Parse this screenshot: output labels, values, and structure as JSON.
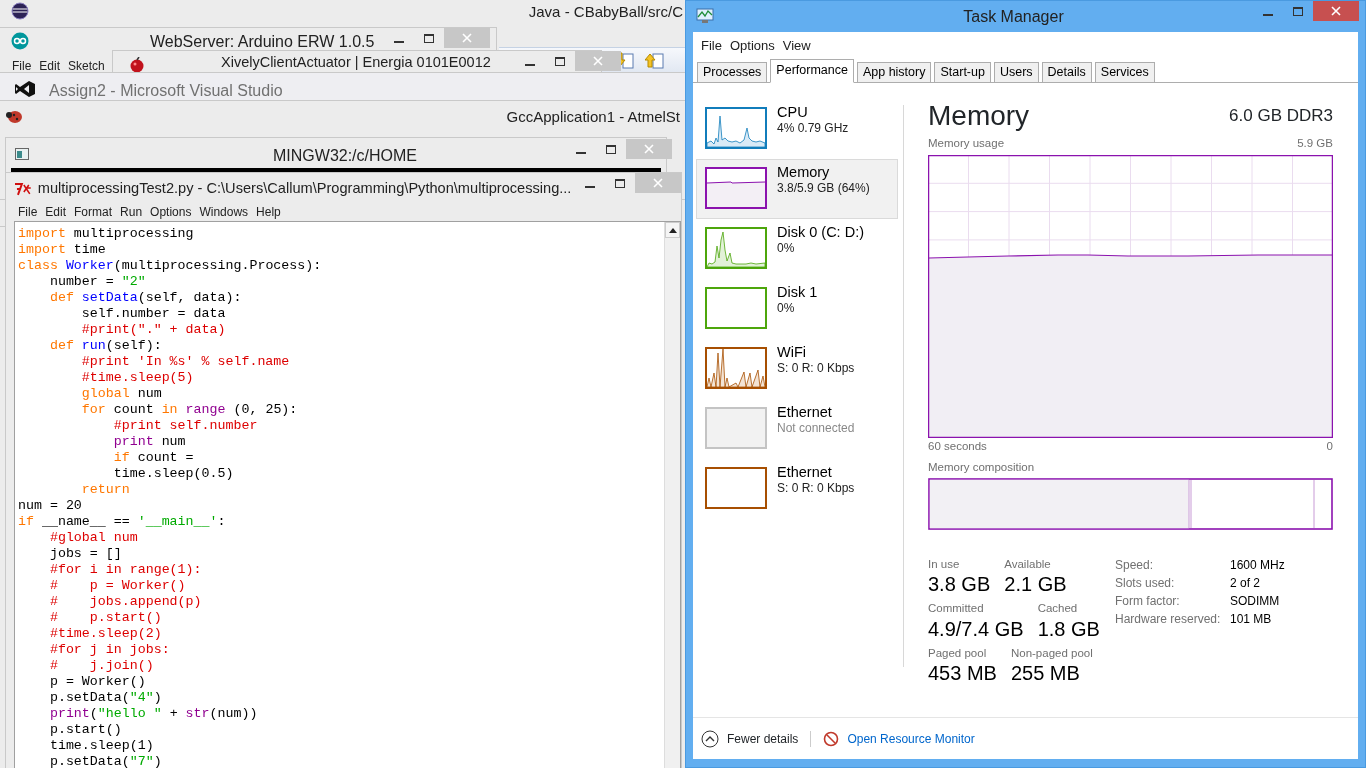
{
  "background_windows": [
    {
      "kind": "eclipse",
      "title": "Java - CBabyBall/src/C"
    },
    {
      "kind": "arduino",
      "title": "WebServer: Arduino ERW 1.0.5",
      "menu": [
        "File",
        "Edit",
        "Sketch"
      ]
    },
    {
      "kind": "energia",
      "title": "XivelyClientActuator | Energia 0101E0012"
    },
    {
      "kind": "visualstudio",
      "title": "Assign2 - Microsoft Visual Studio"
    },
    {
      "kind": "atmel",
      "title": "GccApplication1 - AtmelSt"
    },
    {
      "kind": "mingw",
      "title": "MINGW32:/c/HOME"
    }
  ],
  "editor": {
    "title": "multiprocessingTest2.py - C:\\Users\\Callum\\Programming\\Python\\multiprocessing...",
    "menu": [
      "File",
      "Edit",
      "Format",
      "Run",
      "Options",
      "Windows",
      "Help"
    ],
    "lines": [
      [
        {
          "kind": "keyword",
          "text": "import"
        },
        {
          "kind": "plain",
          "text": " multiprocessing"
        }
      ],
      [
        {
          "kind": "keyword",
          "text": "import"
        },
        {
          "kind": "plain",
          "text": " time"
        }
      ],
      [
        {
          "kind": "keyword",
          "text": "class "
        },
        {
          "kind": "definition",
          "text": "Worker"
        },
        {
          "kind": "plain",
          "text": "(multiprocessing.Process):"
        }
      ],
      [
        {
          "kind": "plain",
          "text": "    number = "
        },
        {
          "kind": "string",
          "text": "\"2\""
        }
      ],
      [
        {
          "kind": "keyword",
          "text": "    def "
        },
        {
          "kind": "definition",
          "text": "setData"
        },
        {
          "kind": "plain",
          "text": "(self, data):"
        }
      ],
      [
        {
          "kind": "plain",
          "text": "        self.number = data"
        }
      ],
      [
        {
          "kind": "comment",
          "text": "        #print(\".\" + data)"
        }
      ],
      [
        {
          "kind": "keyword",
          "text": "    def "
        },
        {
          "kind": "definition",
          "text": "run"
        },
        {
          "kind": "plain",
          "text": "(self):"
        }
      ],
      [
        {
          "kind": "comment",
          "text": "        #print 'In %s' % self.name"
        }
      ],
      [
        {
          "kind": "comment",
          "text": "        #time.sleep(5)"
        }
      ],
      [
        {
          "kind": "keyword",
          "text": "        global"
        },
        {
          "kind": "plain",
          "text": " num"
        }
      ],
      [
        {
          "kind": "keyword",
          "text": "        for"
        },
        {
          "kind": "plain",
          "text": " count "
        },
        {
          "kind": "keyword",
          "text": "in "
        },
        {
          "kind": "builtin",
          "text": "range"
        },
        {
          "kind": "plain",
          "text": " (0, 25):"
        }
      ],
      [
        {
          "kind": "comment",
          "text": "            #print self.number"
        }
      ],
      [
        {
          "kind": "builtin",
          "text": "            print"
        },
        {
          "kind": "plain",
          "text": " num"
        }
      ],
      [
        {
          "kind": "keyword",
          "text": "            if"
        },
        {
          "kind": "plain",
          "text": " count ="
        }
      ],
      [
        {
          "kind": "plain",
          "text": "            time.sleep(0.5)"
        }
      ],
      [
        {
          "kind": "keyword",
          "text": "        return"
        }
      ],
      [
        {
          "kind": "plain",
          "text": "num = 20"
        }
      ],
      [
        {
          "kind": "keyword",
          "text": "if"
        },
        {
          "kind": "plain",
          "text": " __name__ == "
        },
        {
          "kind": "string",
          "text": "'__main__'"
        },
        {
          "kind": "plain",
          "text": ":"
        }
      ],
      [
        {
          "kind": "comment",
          "text": "    #global num"
        }
      ],
      [
        {
          "kind": "plain",
          "text": "    jobs = []"
        }
      ],
      [
        {
          "kind": "comment",
          "text": "    #for i in range(1):"
        }
      ],
      [
        {
          "kind": "comment",
          "text": "    #    p = Worker()"
        }
      ],
      [
        {
          "kind": "comment",
          "text": "    #    jobs.append(p)"
        }
      ],
      [
        {
          "kind": "comment",
          "text": "    #    p.start()"
        }
      ],
      [
        {
          "kind": "comment",
          "text": "    #time.sleep(2)"
        }
      ],
      [
        {
          "kind": "comment",
          "text": "    #for j in jobs:"
        }
      ],
      [
        {
          "kind": "comment",
          "text": "    #    j.join()"
        }
      ],
      [
        {
          "kind": "plain",
          "text": "    p = Worker()"
        }
      ],
      [
        {
          "kind": "plain",
          "text": "    p.setData("
        },
        {
          "kind": "string",
          "text": "\"4\""
        },
        {
          "kind": "plain",
          "text": ")"
        }
      ],
      [
        {
          "kind": "builtin",
          "text": "    print"
        },
        {
          "kind": "plain",
          "text": "("
        },
        {
          "kind": "string",
          "text": "\"hello \""
        },
        {
          "kind": "plain",
          "text": " + "
        },
        {
          "kind": "builtin",
          "text": "str"
        },
        {
          "kind": "plain",
          "text": "(num))"
        }
      ],
      [
        {
          "kind": "plain",
          "text": "    p.start()"
        }
      ],
      [
        {
          "kind": "plain",
          "text": "    time.sleep(1)"
        }
      ],
      [
        {
          "kind": "plain",
          "text": "    p.setData("
        },
        {
          "kind": "string",
          "text": "\"7\""
        },
        {
          "kind": "plain",
          "text": ")"
        }
      ]
    ]
  },
  "task_manager": {
    "title": "Task Manager",
    "menu": [
      "File",
      "Options",
      "View"
    ],
    "tabs": [
      {
        "label": "Processes",
        "selected": false
      },
      {
        "label": "Performance",
        "selected": true
      },
      {
        "label": "App history",
        "selected": false
      },
      {
        "label": "Start-up",
        "selected": false
      },
      {
        "label": "Users",
        "selected": false
      },
      {
        "label": "Details",
        "selected": false
      },
      {
        "label": "Services",
        "selected": false
      }
    ],
    "resources": [
      {
        "kind": "cpu",
        "name": "CPU",
        "detail": "4%  0.79 GHz",
        "color": "#117dbb",
        "selected": false
      },
      {
        "kind": "memory",
        "name": "Memory",
        "detail": "3.8/5.9 GB (64%)",
        "color": "#8b12ae",
        "selected": true
      },
      {
        "kind": "disk",
        "name": "Disk 0 (C: D:)",
        "detail": "0%",
        "color": "#4da60c",
        "selected": false
      },
      {
        "kind": "idle",
        "name": "Disk 1",
        "detail": "0%",
        "color": "#4da60c",
        "selected": false
      },
      {
        "kind": "network",
        "name": "WiFi",
        "detail": "S: 0 R: 0 Kbps",
        "color": "#a74f01",
        "selected": false
      },
      {
        "kind": "offline",
        "name": "Ethernet",
        "detail": "Not connected",
        "color": "#c4c4c4",
        "selected": false
      },
      {
        "kind": "idle",
        "name": "Ethernet",
        "detail": "S: 0 R: 0 Kbps",
        "color": "#a74f01",
        "selected": false
      }
    ],
    "detail": {
      "heading": "Memory",
      "subtitle": "6.0 GB DDR3",
      "usage_label": "Memory usage",
      "usage_max": "5.9 GB",
      "time_span": "60 seconds",
      "time_end": "0",
      "composition_label": "Memory composition",
      "stats": [
        [
          {
            "label": "In use",
            "value": "3.8 GB"
          },
          {
            "label": "Available",
            "value": "2.1 GB"
          }
        ],
        [
          {
            "label": "Committed",
            "value": "4.9/7.4 GB"
          },
          {
            "label": "Cached",
            "value": "1.8 GB"
          }
        ],
        [
          {
            "label": "Paged pool",
            "value": "453 MB"
          },
          {
            "label": "Non-paged pool",
            "value": "255 MB"
          }
        ]
      ],
      "properties": [
        {
          "label": "Speed:",
          "value": "1600 MHz"
        },
        {
          "label": "Slots used:",
          "value": "2 of 2"
        },
        {
          "label": "Form factor:",
          "value": "SODIMM"
        },
        {
          "label": "Hardware reserved:",
          "value": "101 MB"
        }
      ]
    },
    "fewer_details": "Fewer details",
    "resource_monitor": "Open Resource Monitor"
  }
}
